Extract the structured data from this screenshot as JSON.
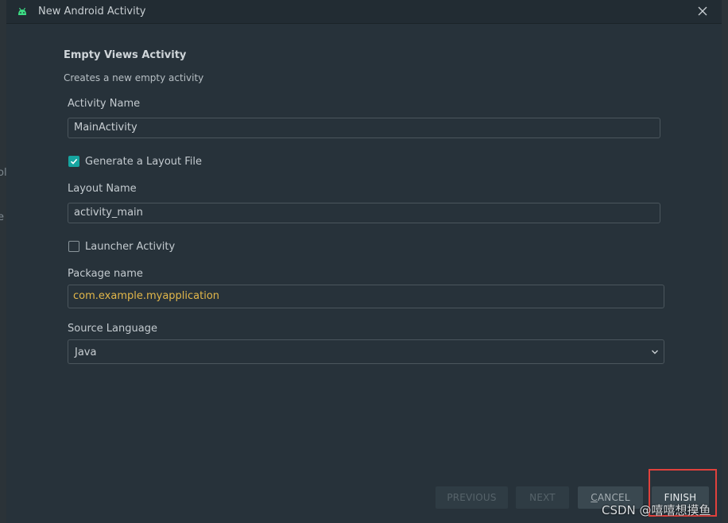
{
  "window": {
    "title": "New Android Activity",
    "icon": "android-icon",
    "close_icon": "close-icon"
  },
  "backdrop": {
    "glyph_1": "ol",
    "glyph_2": "e"
  },
  "template": {
    "heading": "Empty Views Activity",
    "description": "Creates a new empty activity"
  },
  "form": {
    "activity_name_label": "Activity Name",
    "activity_name_value": "MainActivity",
    "generate_layout_label": "Generate a Layout File",
    "generate_layout_checked": true,
    "layout_name_label": "Layout Name",
    "layout_name_value": "activity_main",
    "launcher_activity_label": "Launcher Activity",
    "launcher_activity_checked": false,
    "package_name_label": "Package name",
    "package_name_value": "com.example.myapplication",
    "source_language_label": "Source Language",
    "source_language_value": "Java"
  },
  "buttons": {
    "previous": "PREVIOUS",
    "next": "NEXT",
    "cancel_first": "C",
    "cancel_rest": "ANCEL",
    "finish": "FINISH"
  },
  "watermark": "CSDN @嘻嘻想摸鱼",
  "colors": {
    "accent_checkbox": "#16a5a0",
    "package_text": "#e2b74a",
    "highlight_border": "#e0413c"
  }
}
